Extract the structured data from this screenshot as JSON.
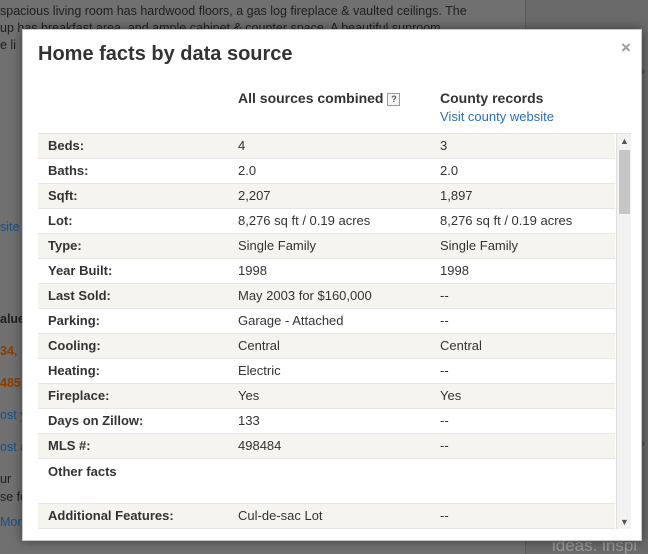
{
  "background": {
    "text_lines": [
      "spacious living room has hardwood floors, a gas log fireplace & vaulted ceilings. The",
      "up has breakfast area, and ample cabinet & counter space. A beautiful sunroom",
      "e li"
    ],
    "left_fragments": [
      "site",
      "alue",
      "34,",
      "485",
      "ost y",
      "ost a",
      "ur",
      "se fo",
      "Mor"
    ],
    "ideas_text": "ideas. inspi"
  },
  "modal": {
    "title": "Home facts by data source",
    "close_label": "×",
    "columns": {
      "combined": "All sources combined",
      "help": "?",
      "county": "County records",
      "county_link": "Visit county website"
    },
    "rows": [
      {
        "label": "Beds:",
        "combined": "4",
        "county": "3"
      },
      {
        "label": "Baths:",
        "combined": "2.0",
        "county": "2.0"
      },
      {
        "label": "Sqft:",
        "combined": "2,207",
        "county": "1,897"
      },
      {
        "label": "Lot:",
        "combined": "8,276 sq ft / 0.19 acres",
        "county": "8,276 sq ft / 0.19 acres"
      },
      {
        "label": "Type:",
        "combined": "Single Family",
        "county": "Single Family"
      },
      {
        "label": "Year Built:",
        "combined": "1998",
        "county": "1998"
      },
      {
        "label": "Last Sold:",
        "combined": "May 2003 for $160,000",
        "county": "--"
      },
      {
        "label": "Parking:",
        "combined": "Garage - Attached",
        "county": "--"
      },
      {
        "label": "Cooling:",
        "combined": "Central",
        "county": "Central"
      },
      {
        "label": "Heating:",
        "combined": "Electric",
        "county": "--"
      },
      {
        "label": "Fireplace:",
        "combined": "Yes",
        "county": "Yes"
      },
      {
        "label": "Days on Zillow:",
        "combined": "133",
        "county": "--"
      },
      {
        "label": "MLS #:",
        "combined": "498484",
        "county": "--"
      }
    ],
    "section_other": "Other facts",
    "extra_rows": [
      {
        "label": "Additional Features:",
        "combined": "Cul-de-sac Lot",
        "county": "--"
      }
    ]
  }
}
